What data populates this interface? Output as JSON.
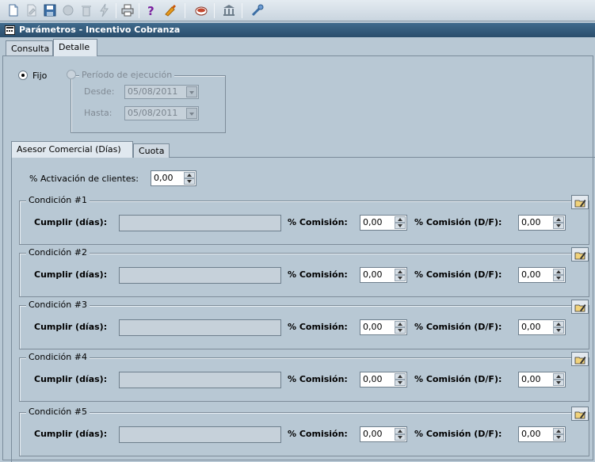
{
  "toolbar": {
    "icons": [
      "new-document-icon",
      "edit-document-icon",
      "save-icon",
      "record-icon",
      "delete-icon",
      "process-icon",
      "print-icon",
      "help-icon",
      "clean-icon",
      "exit-icon",
      "bank-icon",
      "tools-icon"
    ]
  },
  "window": {
    "title": "Parámetros - Incentivo Cobranza"
  },
  "outer_tabs": [
    {
      "label": "Consulta"
    },
    {
      "label": "Detalle",
      "active": true
    }
  ],
  "mode": {
    "fixed_label": "Fijo",
    "fixed_selected": true,
    "period_label": "Período de ejecución",
    "period_selected": false,
    "from_label": "Desde:",
    "from_value": "05/08/2011",
    "to_label": "Hasta:",
    "to_value": "05/08/2011"
  },
  "inner_tabs": [
    {
      "label": "Asesor Comercial (Días)",
      "active": true
    },
    {
      "label": "Cuota"
    }
  ],
  "activation": {
    "label": "% Activación de clientes:",
    "value": "0,00"
  },
  "condition_fields": {
    "cumplir_label": "Cumplir (días):",
    "comision_label": "% Comisión:",
    "comision_df_label": "% Comisión (D/F):"
  },
  "conditions": [
    {
      "title": "Condición #1",
      "cumplir": "",
      "comision": "0,00",
      "comision_df": "0,00"
    },
    {
      "title": "Condición #2",
      "cumplir": "",
      "comision": "0,00",
      "comision_df": "0,00"
    },
    {
      "title": "Condición #3",
      "cumplir": "",
      "comision": "0,00",
      "comision_df": "0,00"
    },
    {
      "title": "Condición #4",
      "cumplir": "",
      "comision": "0,00",
      "comision_df": "0,00"
    },
    {
      "title": "Condición #5",
      "cumplir": "",
      "comision": "0,00",
      "comision_df": "0,00"
    }
  ]
}
